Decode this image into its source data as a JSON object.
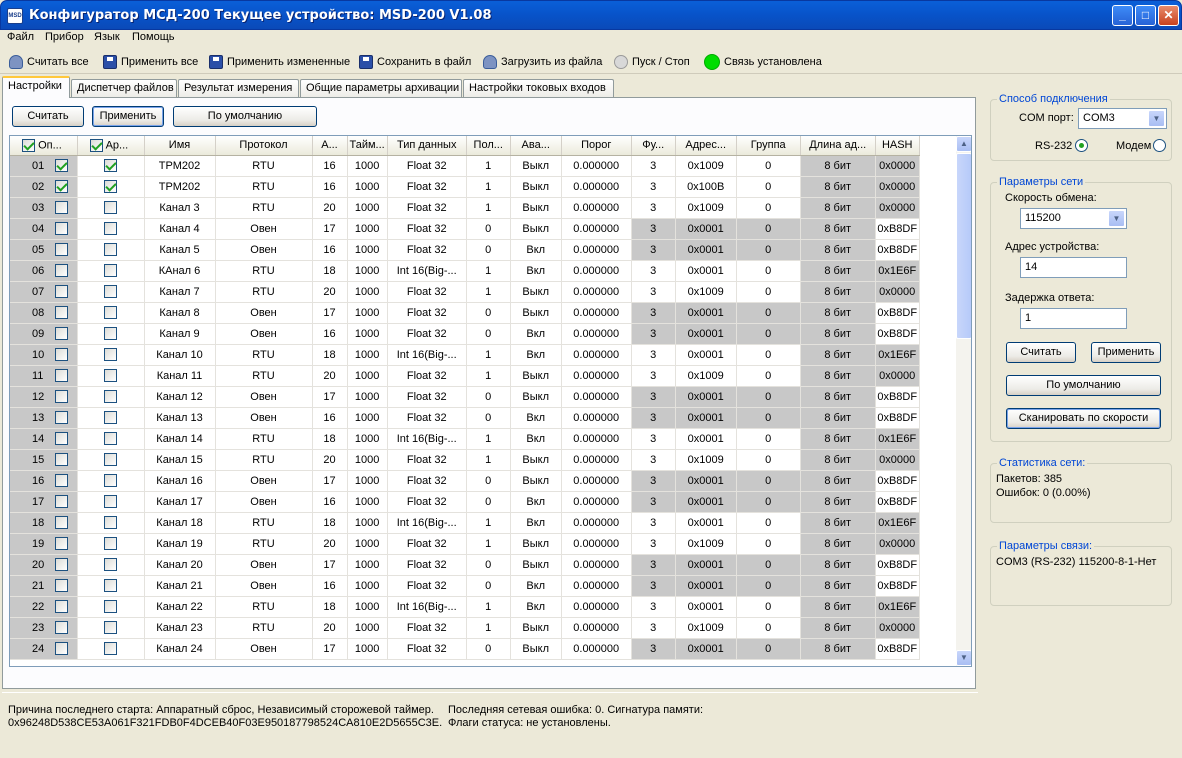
{
  "window": {
    "title": "Конфигуратор МСД-200   Текущее устройство: MSD-200 V1.08",
    "icon": "MSD"
  },
  "menu": [
    "Файл",
    "Прибор",
    "Язык",
    "Помощь"
  ],
  "toolbar": {
    "read_all": "Считать все",
    "apply_all": "Применить все",
    "apply_changed": "Применить измененные",
    "save_file": "Сохранить в файл",
    "load_file": "Загрузить из файла",
    "start_stop": "Пуск / Стоп",
    "connection": "Связь установлена",
    "connection_color": "#00DD00"
  },
  "tabs": [
    "Настройки",
    "Диспетчер файлов",
    "Результат измерения",
    "Общие параметры архивации",
    "Настройки токовых входов"
  ],
  "active_tab": 0,
  "panel_buttons": {
    "read": "Считать",
    "apply": "Применить",
    "defaults": "По умолчанию"
  },
  "grid": {
    "columns": [
      "Оп...",
      "Ар...",
      "Имя",
      "Протокол",
      "А...",
      "Тайм...",
      "Тип данных",
      "Пол...",
      "Ава...",
      "Порог",
      "Фу...",
      "Адрес...",
      "Группа",
      "Длина ад...",
      "HASH"
    ],
    "header_checks": [
      true,
      true
    ],
    "rows": [
      {
        "n": "01",
        "op": true,
        "ar": true,
        "name": "ТРМ202",
        "proto": "RTU",
        "a": "16",
        "t": "1000",
        "type": "Float 32",
        "pol": "1",
        "alarm": "Выкл",
        "thr": "0.000000",
        "fn": "3",
        "addr": "0x1009",
        "grp": "0",
        "len": "8 бит",
        "hash": "0x0000"
      },
      {
        "n": "02",
        "op": true,
        "ar": true,
        "name": "ТРМ202",
        "proto": "RTU",
        "a": "16",
        "t": "1000",
        "type": "Float 32",
        "pol": "1",
        "alarm": "Выкл",
        "thr": "0.000000",
        "fn": "3",
        "addr": "0x100B",
        "grp": "0",
        "len": "8 бит",
        "hash": "0x0000"
      },
      {
        "n": "03",
        "op": false,
        "ar": false,
        "name": "Канал 3",
        "proto": "RTU",
        "a": "20",
        "t": "1000",
        "type": "Float 32",
        "pol": "1",
        "alarm": "Выкл",
        "thr": "0.000000",
        "fn": "3",
        "addr": "0x1009",
        "grp": "0",
        "len": "8 бит",
        "hash": "0x0000"
      },
      {
        "n": "04",
        "op": false,
        "ar": false,
        "name": "Канал 4",
        "proto": "Овен",
        "a": "17",
        "t": "1000",
        "type": "Float 32",
        "pol": "0",
        "alarm": "Выкл",
        "thr": "0.000000",
        "fn": "3",
        "addr": "0x0001",
        "grp": "0",
        "len": "8 бит",
        "hash": "0xB8DF"
      },
      {
        "n": "05",
        "op": false,
        "ar": false,
        "name": "Канал 5",
        "proto": "Овен",
        "a": "16",
        "t": "1000",
        "type": "Float 32",
        "pol": "0",
        "alarm": "Вкл",
        "thr": "0.000000",
        "fn": "3",
        "addr": "0x0001",
        "grp": "0",
        "len": "8 бит",
        "hash": "0xB8DF"
      },
      {
        "n": "06",
        "op": false,
        "ar": false,
        "name": "КАнал 6",
        "proto": "RTU",
        "a": "18",
        "t": "1000",
        "type": "Int 16(Big-...",
        "pol": "1",
        "alarm": "Вкл",
        "thr": "0.000000",
        "fn": "3",
        "addr": "0x0001",
        "grp": "0",
        "len": "8 бит",
        "hash": "0x1E6F"
      },
      {
        "n": "07",
        "op": false,
        "ar": false,
        "name": "Канал 7",
        "proto": "RTU",
        "a": "20",
        "t": "1000",
        "type": "Float 32",
        "pol": "1",
        "alarm": "Выкл",
        "thr": "0.000000",
        "fn": "3",
        "addr": "0x1009",
        "grp": "0",
        "len": "8 бит",
        "hash": "0x0000"
      },
      {
        "n": "08",
        "op": false,
        "ar": false,
        "name": "Канал 8",
        "proto": "Овен",
        "a": "17",
        "t": "1000",
        "type": "Float 32",
        "pol": "0",
        "alarm": "Выкл",
        "thr": "0.000000",
        "fn": "3",
        "addr": "0x0001",
        "grp": "0",
        "len": "8 бит",
        "hash": "0xB8DF"
      },
      {
        "n": "09",
        "op": false,
        "ar": false,
        "name": "Канал 9",
        "proto": "Овен",
        "a": "16",
        "t": "1000",
        "type": "Float 32",
        "pol": "0",
        "alarm": "Вкл",
        "thr": "0.000000",
        "fn": "3",
        "addr": "0x0001",
        "grp": "0",
        "len": "8 бит",
        "hash": "0xB8DF"
      },
      {
        "n": "10",
        "op": false,
        "ar": false,
        "name": "Канал 10",
        "proto": "RTU",
        "a": "18",
        "t": "1000",
        "type": "Int 16(Big-...",
        "pol": "1",
        "alarm": "Вкл",
        "thr": "0.000000",
        "fn": "3",
        "addr": "0x0001",
        "grp": "0",
        "len": "8 бит",
        "hash": "0x1E6F"
      },
      {
        "n": "11",
        "op": false,
        "ar": false,
        "name": "Канал 11",
        "proto": "RTU",
        "a": "20",
        "t": "1000",
        "type": "Float 32",
        "pol": "1",
        "alarm": "Выкл",
        "thr": "0.000000",
        "fn": "3",
        "addr": "0x1009",
        "grp": "0",
        "len": "8 бит",
        "hash": "0x0000"
      },
      {
        "n": "12",
        "op": false,
        "ar": false,
        "name": "Канал 12",
        "proto": "Овен",
        "a": "17",
        "t": "1000",
        "type": "Float 32",
        "pol": "0",
        "alarm": "Выкл",
        "thr": "0.000000",
        "fn": "3",
        "addr": "0x0001",
        "grp": "0",
        "len": "8 бит",
        "hash": "0xB8DF"
      },
      {
        "n": "13",
        "op": false,
        "ar": false,
        "name": "Канал 13",
        "proto": "Овен",
        "a": "16",
        "t": "1000",
        "type": "Float 32",
        "pol": "0",
        "alarm": "Вкл",
        "thr": "0.000000",
        "fn": "3",
        "addr": "0x0001",
        "grp": "0",
        "len": "8 бит",
        "hash": "0xB8DF"
      },
      {
        "n": "14",
        "op": false,
        "ar": false,
        "name": "Канал 14",
        "proto": "RTU",
        "a": "18",
        "t": "1000",
        "type": "Int 16(Big-...",
        "pol": "1",
        "alarm": "Вкл",
        "thr": "0.000000",
        "fn": "3",
        "addr": "0x0001",
        "grp": "0",
        "len": "8 бит",
        "hash": "0x1E6F"
      },
      {
        "n": "15",
        "op": false,
        "ar": false,
        "name": "Канал 15",
        "proto": "RTU",
        "a": "20",
        "t": "1000",
        "type": "Float 32",
        "pol": "1",
        "alarm": "Выкл",
        "thr": "0.000000",
        "fn": "3",
        "addr": "0x1009",
        "grp": "0",
        "len": "8 бит",
        "hash": "0x0000"
      },
      {
        "n": "16",
        "op": false,
        "ar": false,
        "name": "Канал 16",
        "proto": "Овен",
        "a": "17",
        "t": "1000",
        "type": "Float 32",
        "pol": "0",
        "alarm": "Выкл",
        "thr": "0.000000",
        "fn": "3",
        "addr": "0x0001",
        "grp": "0",
        "len": "8 бит",
        "hash": "0xB8DF"
      },
      {
        "n": "17",
        "op": false,
        "ar": false,
        "name": "Канал 17",
        "proto": "Овен",
        "a": "16",
        "t": "1000",
        "type": "Float 32",
        "pol": "0",
        "alarm": "Вкл",
        "thr": "0.000000",
        "fn": "3",
        "addr": "0x0001",
        "grp": "0",
        "len": "8 бит",
        "hash": "0xB8DF"
      },
      {
        "n": "18",
        "op": false,
        "ar": false,
        "name": "Канал 18",
        "proto": "RTU",
        "a": "18",
        "t": "1000",
        "type": "Int 16(Big-...",
        "pol": "1",
        "alarm": "Вкл",
        "thr": "0.000000",
        "fn": "3",
        "addr": "0x0001",
        "grp": "0",
        "len": "8 бит",
        "hash": "0x1E6F"
      },
      {
        "n": "19",
        "op": false,
        "ar": false,
        "name": "Канал 19",
        "proto": "RTU",
        "a": "20",
        "t": "1000",
        "type": "Float 32",
        "pol": "1",
        "alarm": "Выкл",
        "thr": "0.000000",
        "fn": "3",
        "addr": "0x1009",
        "grp": "0",
        "len": "8 бит",
        "hash": "0x0000"
      },
      {
        "n": "20",
        "op": false,
        "ar": false,
        "name": "Канал 20",
        "proto": "Овен",
        "a": "17",
        "t": "1000",
        "type": "Float 32",
        "pol": "0",
        "alarm": "Выкл",
        "thr": "0.000000",
        "fn": "3",
        "addr": "0x0001",
        "grp": "0",
        "len": "8 бит",
        "hash": "0xB8DF"
      },
      {
        "n": "21",
        "op": false,
        "ar": false,
        "name": "Канал 21",
        "proto": "Овен",
        "a": "16",
        "t": "1000",
        "type": "Float 32",
        "pol": "0",
        "alarm": "Вкл",
        "thr": "0.000000",
        "fn": "3",
        "addr": "0x0001",
        "grp": "0",
        "len": "8 бит",
        "hash": "0xB8DF"
      },
      {
        "n": "22",
        "op": false,
        "ar": false,
        "name": "Канал 22",
        "proto": "RTU",
        "a": "18",
        "t": "1000",
        "type": "Int 16(Big-...",
        "pol": "1",
        "alarm": "Вкл",
        "thr": "0.000000",
        "fn": "3",
        "addr": "0x0001",
        "grp": "0",
        "len": "8 бит",
        "hash": "0x1E6F"
      },
      {
        "n": "23",
        "op": false,
        "ar": false,
        "name": "Канал 23",
        "proto": "RTU",
        "a": "20",
        "t": "1000",
        "type": "Float 32",
        "pol": "1",
        "alarm": "Выкл",
        "thr": "0.000000",
        "fn": "3",
        "addr": "0x1009",
        "grp": "0",
        "len": "8 бит",
        "hash": "0x0000"
      },
      {
        "n": "24",
        "op": false,
        "ar": false,
        "name": "Канал 24",
        "proto": "Овен",
        "a": "17",
        "t": "1000",
        "type": "Float 32",
        "pol": "0",
        "alarm": "Выкл",
        "thr": "0.000000",
        "fn": "3",
        "addr": "0x0001",
        "grp": "0",
        "len": "8 бит",
        "hash": "0xB8DF"
      }
    ]
  },
  "connection_group": {
    "legend": "Способ подключения",
    "com_label": "COM порт:",
    "com_value": "COM3",
    "rs232": "RS-232",
    "modem": "Модем",
    "rs232_selected": true
  },
  "network_params": {
    "legend": "Параметры сети",
    "speed_label": "Скорость обмена:",
    "speed_value": "115200",
    "addr_label": "Адрес устройства:",
    "addr_value": "14",
    "delay_label": "Задержка ответа:",
    "delay_value": "1",
    "read": "Считать",
    "apply": "Применить",
    "defaults": "По умолчанию",
    "scan": "Сканировать по скорости"
  },
  "net_stats": {
    "legend": "Статистика сети:",
    "packets": "Пакетов: 385",
    "errors": "Ошибок: 0 (0.00%)"
  },
  "link_params": {
    "legend": "Параметры связи:",
    "value": "COM3 (RS-232)  115200-8-1-Нет"
  },
  "status": {
    "start_reason": "Причина последнего старта: Аппаратный сброс, Независимый сторожевой таймер.",
    "signature": "0x96248D538CE53A061F321FDB0F4DCEB40F03E950187798524CA810E2D5655C3E.",
    "last_error": "Последняя сетевая ошибка: 0. Сигнатура памяти:",
    "flags": "Флаги статуса: не установлены."
  }
}
